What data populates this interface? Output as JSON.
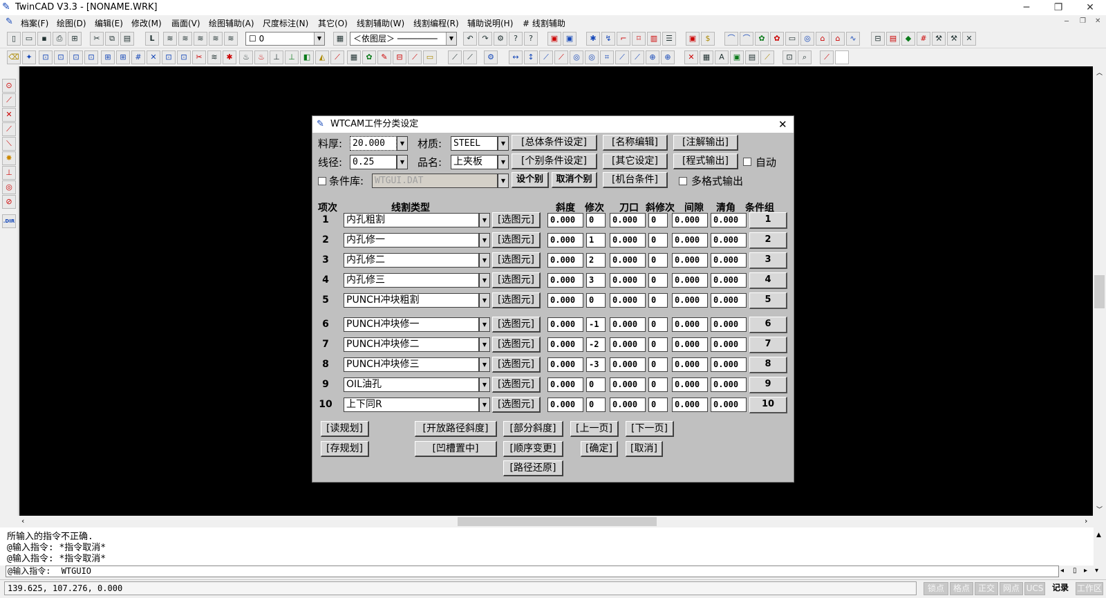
{
  "window": {
    "title": "TwinCAD V3.3 - [NONAME.WRK]"
  },
  "menu": [
    "档案(F)",
    "绘图(D)",
    "编辑(E)",
    "修改(M)",
    "画面(V)",
    "绘图辅助(A)",
    "尺度标注(N)",
    "其它(O)",
    "线割辅助(W)",
    "线割编程(R)",
    "辅助说明(H)",
    "# 线割辅助"
  ],
  "toolbar": {
    "layer_value": "0",
    "linetype_value": "＜依图层＞ ────────"
  },
  "dialog": {
    "title": "WTCAM工件分类设定",
    "thickness_label": "料厚:",
    "thickness_value": "20.000",
    "material_label": "材质:",
    "material_value": "STEEL",
    "wire_label": "线径:",
    "wire_value": "0.25",
    "partname_label": "品名:",
    "partname_value": "上夹板",
    "library_label": "条件库:",
    "library_value": "WTGUI.DAT",
    "buttons": {
      "overall_cond": "[总体条件设定]",
      "name_edit": "[名称编辑]",
      "note_output": "[注解输出]",
      "indiv_cond": "[个别条件设定]",
      "other_settings": "[其它设定]",
      "program_output": "[程式输出]",
      "set_indiv": "设个别",
      "cancel_indiv": "取消个别",
      "machine_cond": "[机台条件]",
      "read_plan": "[读规划]",
      "save_plan": "[存规划]",
      "open_path_slope": "[开放路径斜度]",
      "groove_center": "[凹槽置中]",
      "partial_slope": "[部分斜度]",
      "order_change": "[顺序变更]",
      "path_restore": "[路径还原]",
      "prev_page": "[上一页]",
      "next_page": "[下一页]",
      "ok": "[确定]",
      "cancel": "[取消]",
      "select_elem": "[选图元]"
    },
    "auto_label": "自动",
    "multi_format_label": "多格式输出",
    "columns": [
      "项次",
      "线割类型",
      "斜度",
      "修次",
      "刀口",
      "斜修次",
      "间隙",
      "清角",
      "条件组"
    ],
    "rows": [
      {
        "no": "1",
        "type": "内孔粗割",
        "slope": "0.000",
        "pass": "0",
        "edge": "0.000",
        "slopepass": "0",
        "gap": "0.000",
        "corner": "0.000",
        "group": "1"
      },
      {
        "no": "2",
        "type": "内孔修一",
        "slope": "0.000",
        "pass": "1",
        "edge": "0.000",
        "slopepass": "0",
        "gap": "0.000",
        "corner": "0.000",
        "group": "2"
      },
      {
        "no": "3",
        "type": "内孔修二",
        "slope": "0.000",
        "pass": "2",
        "edge": "0.000",
        "slopepass": "0",
        "gap": "0.000",
        "corner": "0.000",
        "group": "3"
      },
      {
        "no": "4",
        "type": "内孔修三",
        "slope": "0.000",
        "pass": "3",
        "edge": "0.000",
        "slopepass": "0",
        "gap": "0.000",
        "corner": "0.000",
        "group": "4"
      },
      {
        "no": "5",
        "type": "PUNCH冲块粗割",
        "slope": "0.000",
        "pass": "0",
        "edge": "0.000",
        "slopepass": "0",
        "gap": "0.000",
        "corner": "0.000",
        "group": "5"
      },
      {
        "no": "6",
        "type": "PUNCH冲块修一",
        "slope": "0.000",
        "pass": "-1",
        "edge": "0.000",
        "slopepass": "0",
        "gap": "0.000",
        "corner": "0.000",
        "group": "6"
      },
      {
        "no": "7",
        "type": "PUNCH冲块修二",
        "slope": "0.000",
        "pass": "-2",
        "edge": "0.000",
        "slopepass": "0",
        "gap": "0.000",
        "corner": "0.000",
        "group": "7"
      },
      {
        "no": "8",
        "type": "PUNCH冲块修三",
        "slope": "0.000",
        "pass": "-3",
        "edge": "0.000",
        "slopepass": "0",
        "gap": "0.000",
        "corner": "0.000",
        "group": "8"
      },
      {
        "no": "9",
        "type": "OIL油孔",
        "slope": "0.000",
        "pass": "0",
        "edge": "0.000",
        "slopepass": "0",
        "gap": "0.000",
        "corner": "0.000",
        "group": "9"
      },
      {
        "no": "10",
        "type": "上下同R",
        "slope": "0.000",
        "pass": "0",
        "edge": "0.000",
        "slopepass": "0",
        "gap": "0.000",
        "corner": "0.000",
        "group": "10"
      }
    ]
  },
  "command": {
    "lines": [
      "所输入的指令不正确.",
      "@输入指令:  *指令取消*",
      "@输入指令:  *指令取消*"
    ],
    "prompt": "@输入指令:",
    "input_value": "WTGUIO"
  },
  "status": {
    "coords": "139.625, 107.276, 0.000",
    "buttons": [
      "锁点",
      "格点",
      "正交",
      "网点",
      "UCS",
      "记录",
      "工作区"
    ],
    "active_index": 5
  }
}
